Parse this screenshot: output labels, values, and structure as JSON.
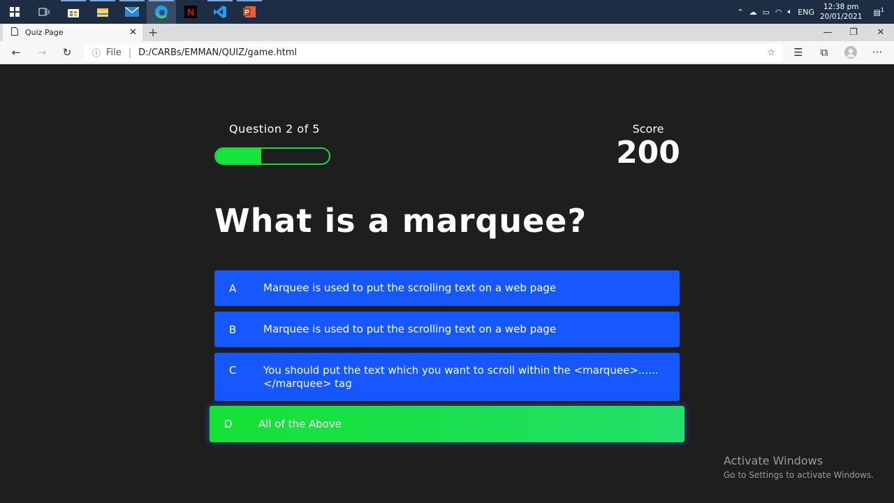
{
  "taskbar": {
    "apps": [
      "start-icon",
      "task-view-icon",
      "store-icon",
      "explorer-icon",
      "mail-icon",
      "edge-icon",
      "netflix-icon",
      "vscode-icon",
      "powerpoint-icon"
    ],
    "tray": {
      "lang": "ENG",
      "time": "12:38 pm",
      "date": "20/01/2021",
      "notification_count": "1"
    }
  },
  "browser": {
    "tab_title": "Quiz Page",
    "url_scheme": "File",
    "url": "D:/CARBs/EMMAN/QUIZ/game.html"
  },
  "quiz": {
    "progress_text": "Question 2 of 5",
    "progress_fraction": 0.4,
    "score_label": "Score",
    "score": "200",
    "question": "What is a marquee?",
    "choices": [
      {
        "prefix": "A",
        "text": "Marquee is used to put the scrolling text on a web page",
        "state": "default"
      },
      {
        "prefix": "B",
        "text": "Marquee is used to put the scrolling text on a web page",
        "state": "default"
      },
      {
        "prefix": "C",
        "text": "You should put the text which you want to scroll within the <marquee>...... </marquee> tag",
        "state": "default"
      },
      {
        "prefix": "D",
        "text": "All of the Above",
        "state": "correct"
      }
    ],
    "colors": {
      "background": "#1e1e1e",
      "choice": "#1757ff",
      "correct": "#14e134",
      "progress": "#17e33d"
    }
  },
  "watermark": {
    "line1": "Activate Windows",
    "line2": "Go to Settings to activate Windows."
  }
}
